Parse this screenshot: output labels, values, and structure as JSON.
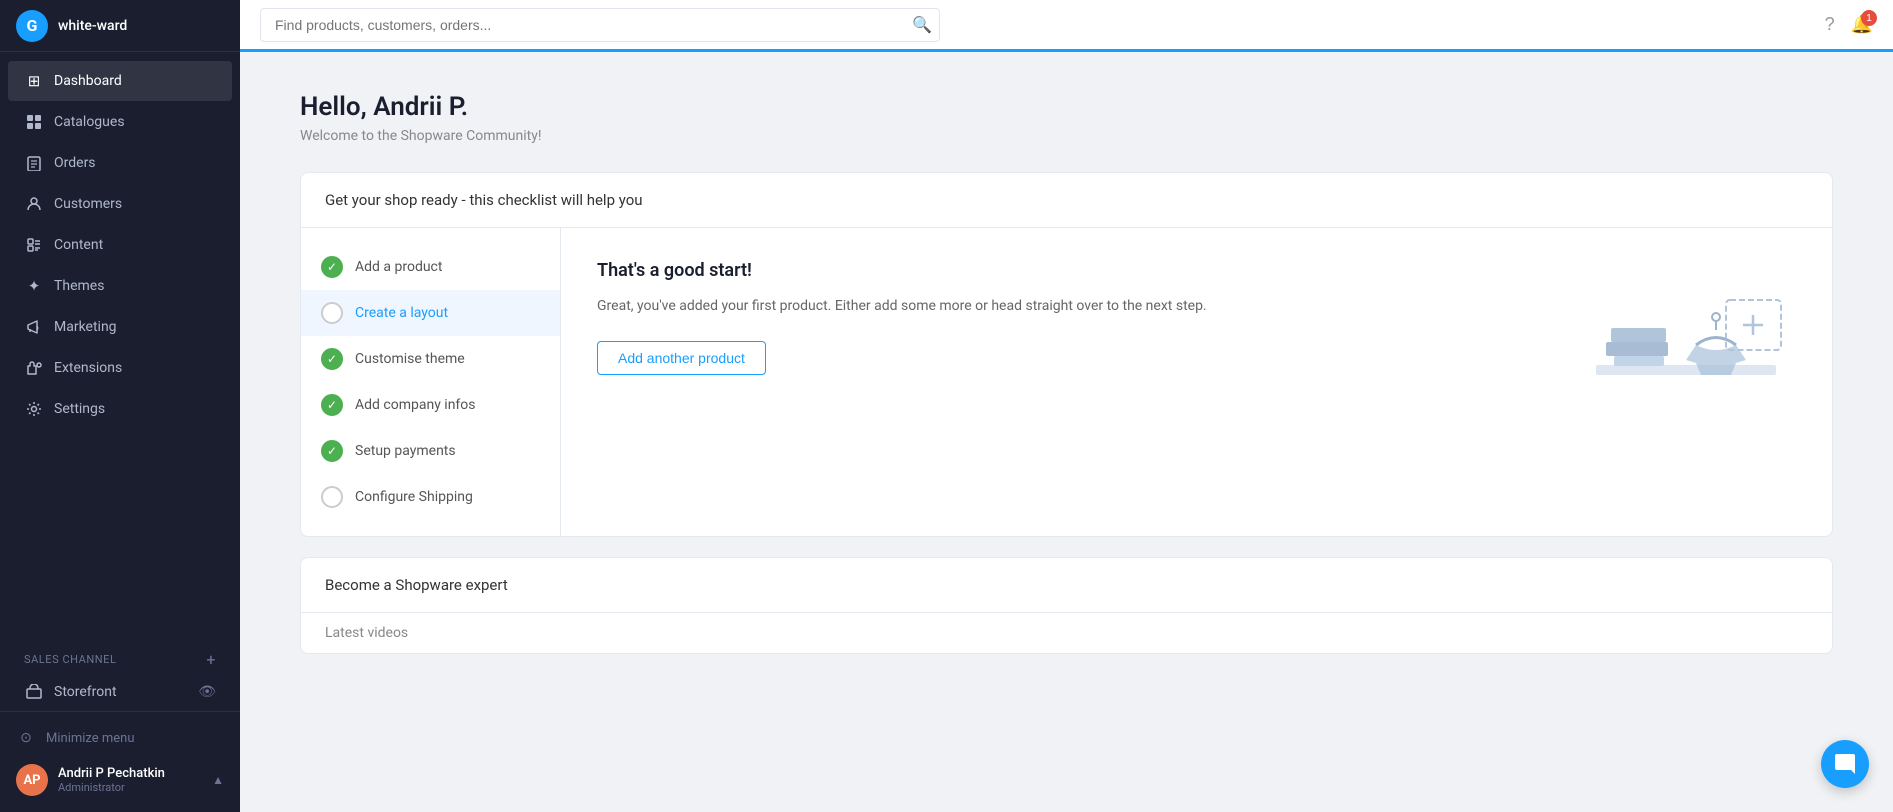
{
  "sidebar": {
    "store_name": "white-ward",
    "logo_letter": "G",
    "nav_items": [
      {
        "id": "dashboard",
        "label": "Dashboard",
        "icon": "⊞"
      },
      {
        "id": "catalogues",
        "label": "Catalogues",
        "icon": "🏷"
      },
      {
        "id": "orders",
        "label": "Orders",
        "icon": "📦"
      },
      {
        "id": "customers",
        "label": "Customers",
        "icon": "👤"
      },
      {
        "id": "content",
        "label": "Content",
        "icon": "📋"
      },
      {
        "id": "themes",
        "label": "Themes",
        "icon": "✦"
      },
      {
        "id": "marketing",
        "label": "Marketing",
        "icon": "📣"
      },
      {
        "id": "extensions",
        "label": "Extensions",
        "icon": "🔌"
      },
      {
        "id": "settings",
        "label": "Settings",
        "icon": "⚙"
      }
    ],
    "sales_channel_label": "Sales Channel",
    "sales_channel_items": [
      {
        "id": "storefront",
        "label": "Storefront",
        "icon": "🖥"
      }
    ],
    "minimize_menu": "Minimize menu",
    "user": {
      "initials": "AP",
      "name": "Andrii P Pechatkin",
      "role": "Administrator"
    }
  },
  "topbar": {
    "search_placeholder": "Find products, customers, orders...",
    "help_icon": "?",
    "notification_count": "1"
  },
  "page": {
    "greeting": "Hello, Andrii P.",
    "subtitle": "Welcome to the Shopware Community!",
    "checklist_title": "Get your shop ready - this checklist will help you",
    "checklist_items": [
      {
        "id": "add-product",
        "label": "Add a product",
        "done": true
      },
      {
        "id": "create-layout",
        "label": "Create a layout",
        "done": false,
        "active": true
      },
      {
        "id": "customise-theme",
        "label": "Customise theme",
        "done": true
      },
      {
        "id": "company-infos",
        "label": "Add company infos",
        "done": true
      },
      {
        "id": "setup-payments",
        "label": "Setup payments",
        "done": true
      },
      {
        "id": "configure-shipping",
        "label": "Configure Shipping",
        "done": false
      }
    ],
    "active_step": {
      "title": "That's a good start!",
      "description": "Great, you've added your first product. Either add some more or head straight over to the next step.",
      "cta_label": "Add another product"
    },
    "expert_card_title": "Become a Shopware expert",
    "latest_videos_label": "Latest videos"
  }
}
